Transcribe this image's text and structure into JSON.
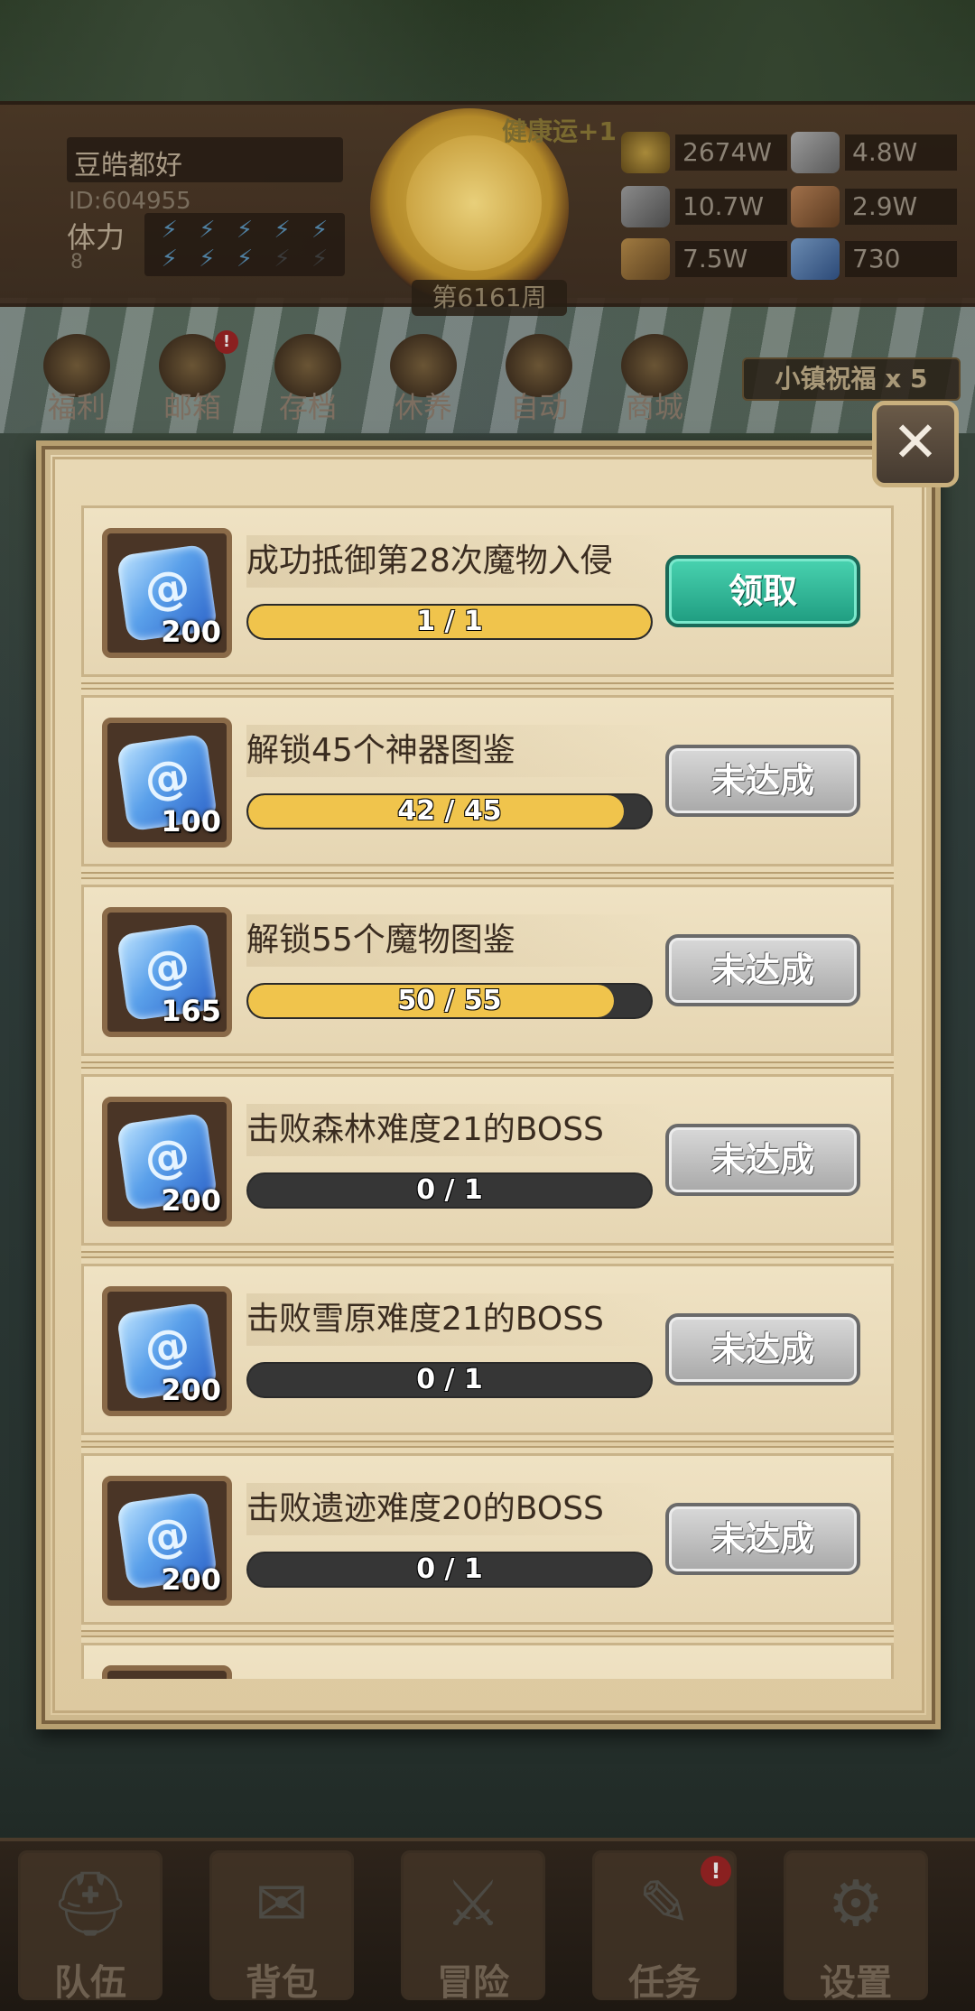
{
  "player": {
    "name": "豆皓都好",
    "id": "ID:604955",
    "stamina_label": "体力",
    "stamina_value": "8",
    "stamina_bolts": [
      true,
      true,
      true,
      true,
      true,
      true,
      true,
      true,
      false,
      false
    ],
    "buff": "健康运+1",
    "week": "第6161周"
  },
  "resources": [
    {
      "icon": "gold-coin-icon",
      "value": "2674W"
    },
    {
      "icon": "iron-ingot-icon",
      "value": "4.8W"
    },
    {
      "icon": "stone-ore-icon",
      "value": "10.7W"
    },
    {
      "icon": "leather-icon",
      "value": "2.9W"
    },
    {
      "icon": "wood-log-icon",
      "value": "7.5W"
    },
    {
      "icon": "crystal-icon",
      "value": "730"
    }
  ],
  "nav": [
    {
      "label": "福利",
      "icon": "welfare-icon"
    },
    {
      "label": "邮箱",
      "icon": "mailbox-icon",
      "badge": "!"
    },
    {
      "label": "存档",
      "icon": "save-icon"
    },
    {
      "label": "休养",
      "icon": "rest-icon"
    },
    {
      "label": "自动",
      "icon": "auto-icon"
    },
    {
      "label": "商城",
      "icon": "shop-icon"
    }
  ],
  "blessing": "小镇祝福 x 5",
  "close_symbol": "✕",
  "tasks": [
    {
      "title": "成功抵御第28次魔物入侵",
      "reward": "200",
      "progress": "1 / 1",
      "fraction": 1.0,
      "button": "领取",
      "claimable": true
    },
    {
      "title": "解锁45个神器图鉴",
      "reward": "100",
      "progress": "42 / 45",
      "fraction": 0.933,
      "button": "未达成",
      "claimable": false
    },
    {
      "title": "解锁55个魔物图鉴",
      "reward": "165",
      "progress": "50 / 55",
      "fraction": 0.909,
      "button": "未达成",
      "claimable": false
    },
    {
      "title": "击败森林难度21的BOSS",
      "reward": "200",
      "progress": "0 / 1",
      "fraction": 0.0,
      "button": "未达成",
      "claimable": false
    },
    {
      "title": "击败雪原难度21的BOSS",
      "reward": "200",
      "progress": "0 / 1",
      "fraction": 0.0,
      "button": "未达成",
      "claimable": false
    },
    {
      "title": "击败遗迹难度20的BOSS",
      "reward": "200",
      "progress": "0 / 1",
      "fraction": 0.0,
      "button": "未达成",
      "claimable": false
    }
  ],
  "bottom_nav": [
    {
      "label": "队伍",
      "icon": "team-helmet-icon",
      "glyph": "⛑"
    },
    {
      "label": "背包",
      "icon": "backpack-icon",
      "glyph": "✉"
    },
    {
      "label": "冒险",
      "icon": "crossed-swords-icon",
      "glyph": "⚔"
    },
    {
      "label": "任务",
      "icon": "quest-scroll-icon",
      "glyph": "✎",
      "badge": "!"
    },
    {
      "label": "设置",
      "icon": "gear-icon",
      "glyph": "⚙"
    }
  ]
}
